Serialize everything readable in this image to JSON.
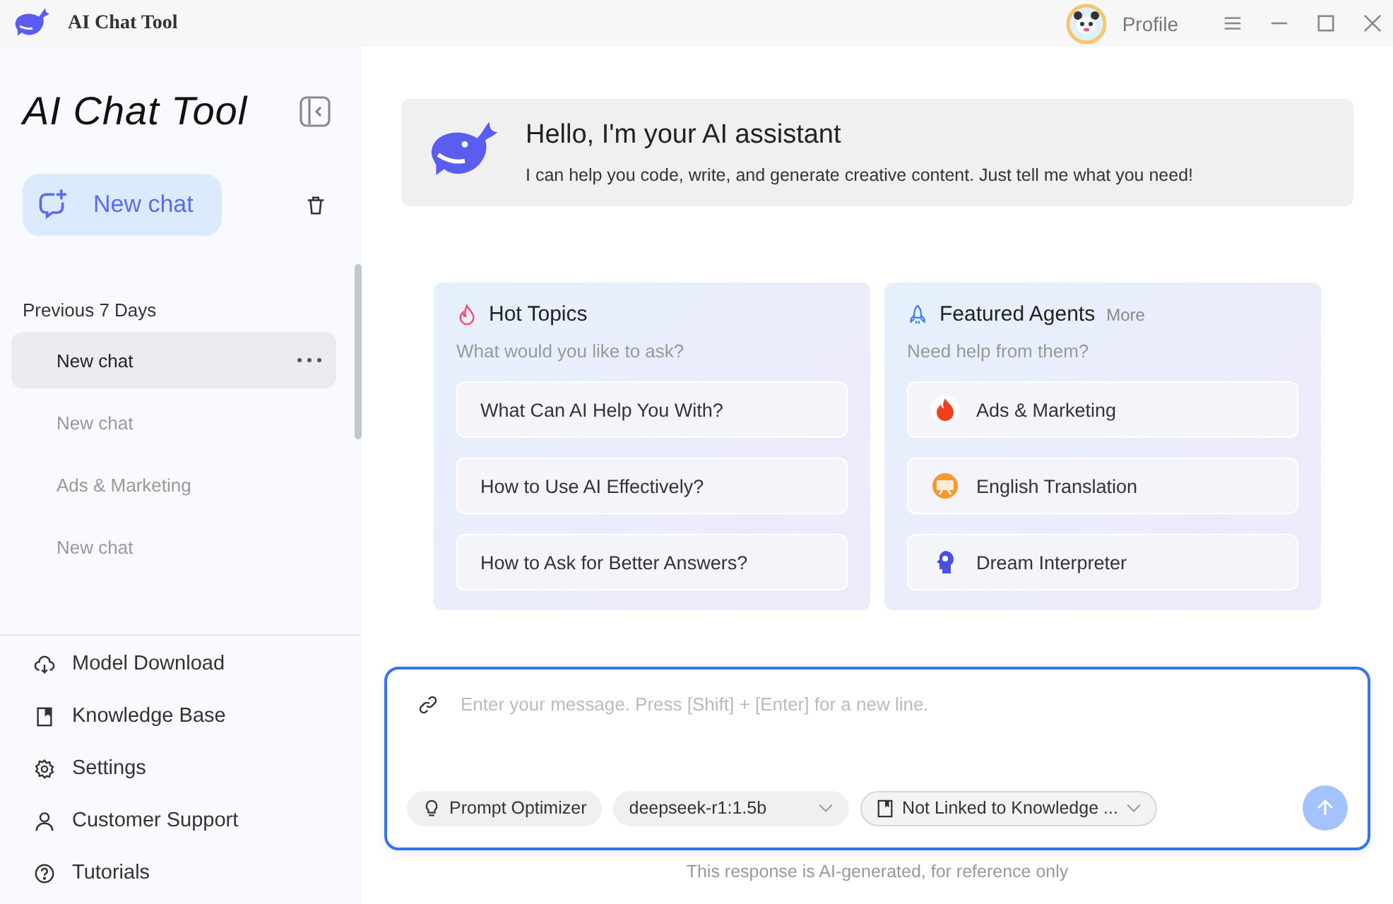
{
  "titlebar": {
    "title": "AI Chat Tool",
    "profile": "Profile"
  },
  "sidebar": {
    "brand": "AI Chat Tool",
    "new_chat": "New chat",
    "section": "Previous 7 Days",
    "chats": [
      {
        "label": "New chat",
        "selected": true
      },
      {
        "label": "New chat",
        "selected": false
      },
      {
        "label": "Ads & Marketing",
        "selected": false
      },
      {
        "label": "New chat",
        "selected": false
      }
    ],
    "nav": [
      {
        "label": "Model Download",
        "kind": "cloud"
      },
      {
        "label": "Knowledge Base",
        "kind": "book"
      },
      {
        "label": "Settings",
        "kind": "gear"
      },
      {
        "label": "Customer Support",
        "kind": "user"
      },
      {
        "label": "Tutorials",
        "kind": "help"
      }
    ]
  },
  "welcome": {
    "title": "Hello, I'm your AI assistant",
    "text": "I can help you code, write, and generate creative content. Just tell me what you need!"
  },
  "hot_topics": {
    "title": "Hot Topics",
    "subtitle": "What would you like to ask?",
    "items": [
      "What Can AI Help You With?",
      "How to Use AI Effectively?",
      "How to Ask for Better Answers?"
    ]
  },
  "featured_agents": {
    "title": "Featured Agents",
    "more": "More",
    "subtitle": "Need help from them?",
    "items": [
      {
        "label": "Ads & Marketing",
        "kind": "fire"
      },
      {
        "label": "English Translation",
        "kind": "abc"
      },
      {
        "label": "Dream Interpreter",
        "kind": "head"
      }
    ]
  },
  "composer": {
    "placeholder": "Enter your message. Press [Shift] + [Enter] for a new line.",
    "optimizer": "Prompt Optimizer",
    "model": "deepseek-r1:1.5b",
    "knowledge": "Not Linked to Knowledge ...",
    "send_disabled": true
  },
  "footer": "This response is AI-generated, for reference only"
}
